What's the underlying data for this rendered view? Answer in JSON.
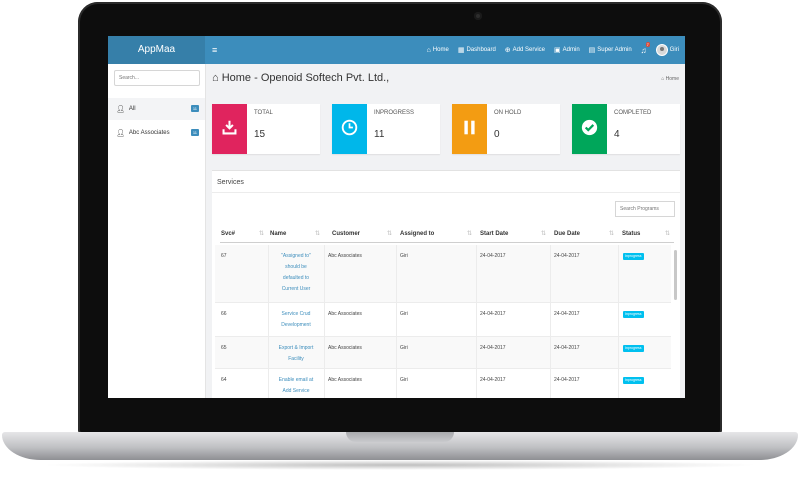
{
  "app": {
    "brand": "AppMaa",
    "menu_toggle": "≡",
    "nav": [
      {
        "icon": "home-icon",
        "glyph": "⌂",
        "label": "Home"
      },
      {
        "icon": "dashboard-icon",
        "glyph": "▦",
        "label": "Dashboard"
      },
      {
        "icon": "plus-circle-icon",
        "glyph": "⊕",
        "label": "Add Service"
      },
      {
        "icon": "admin-icon",
        "glyph": "▣",
        "label": "Admin"
      },
      {
        "icon": "super-admin-icon",
        "glyph": "▤",
        "label": "Super Admin"
      }
    ],
    "notifications": "7",
    "user_name": "Giri"
  },
  "sidebar": {
    "search_placeholder": "Search...",
    "items": [
      {
        "label": "All",
        "count": "11"
      },
      {
        "label": "Abc Associates",
        "count": "11"
      }
    ]
  },
  "page": {
    "title": "Home - Openoid Softech Pvt. Ltd.,",
    "breadcrumb": "Home"
  },
  "stats": [
    {
      "label": "TOTAL",
      "value": "15",
      "color": "#e0245e",
      "icon": "download-icon"
    },
    {
      "label": "INPROGRESS",
      "value": "11",
      "color": "#00b7ea",
      "icon": "clock-icon"
    },
    {
      "label": "ON HOLD",
      "value": "0",
      "color": "#f39c12",
      "icon": "pause-icon"
    },
    {
      "label": "COMPLETED",
      "value": "4",
      "color": "#00a65a",
      "icon": "check-icon"
    }
  ],
  "services": {
    "title": "Services",
    "search_placeholder": "Search Programs",
    "columns": [
      "Svc#",
      "Name",
      "Customer",
      "Assigned to",
      "Start Date",
      "Due Date",
      "Status"
    ],
    "rows": [
      {
        "id": "67",
        "name": [
          "\"Assigned to\"",
          "should be",
          "defaulted to",
          "Current User"
        ],
        "customer": "Abc Associates",
        "assigned": "Giri",
        "start": "24-04-2017",
        "due": "24-04-2017",
        "status": "Inprogress"
      },
      {
        "id": "66",
        "name": [
          "Service Crud",
          "Development"
        ],
        "customer": "Abc Associates",
        "assigned": "Giri",
        "start": "24-04-2017",
        "due": "24-04-2017",
        "status": "Inprogress"
      },
      {
        "id": "65",
        "name": [
          "Export & Import",
          "Facility"
        ],
        "customer": "Abc Associates",
        "assigned": "Giri",
        "start": "24-04-2017",
        "due": "24-04-2017",
        "status": "Inprogress"
      },
      {
        "id": "64",
        "name": [
          "Enable email at",
          "Add Service"
        ],
        "customer": "Abc Associates",
        "assigned": "Giri",
        "start": "24-04-2017",
        "due": "24-04-2017",
        "status": "Inprogress"
      }
    ]
  }
}
